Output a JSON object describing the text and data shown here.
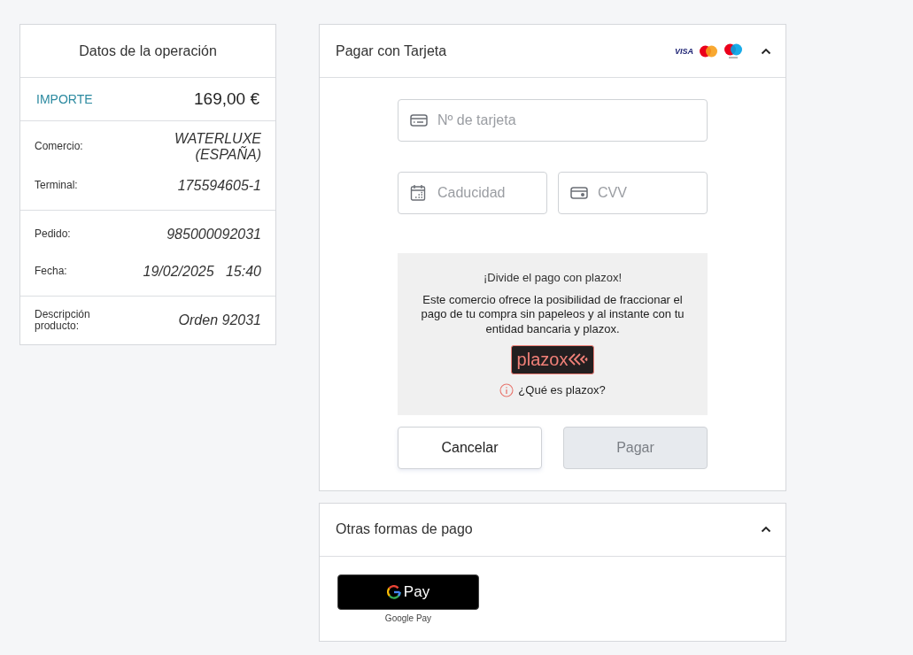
{
  "summary": {
    "title": "Datos de la operación",
    "amount_label": "IMPORTE",
    "amount": "169,00 €",
    "groups": [
      [
        {
          "label": "Comercio:",
          "value": "WATERLUXE (ESPAÑA)"
        },
        {
          "label": "Terminal:",
          "value": "175594605-1"
        }
      ],
      [
        {
          "label": "Pedido:",
          "value": "985000092031"
        },
        {
          "label": "Fecha:",
          "value": "19/02/2025   15:40"
        }
      ],
      [
        {
          "label": "Descripción producto:",
          "value": "Orden 92031"
        }
      ]
    ]
  },
  "card_section": {
    "title": "Pagar con Tarjeta",
    "expanded": true,
    "brand_visa": "VISA",
    "fields": [
      {
        "kind": "card",
        "placeholder": "Nº de tarjeta"
      },
      {
        "kind": "date",
        "placeholder": "Caducidad"
      },
      {
        "kind": "cvv",
        "placeholder": "CVV"
      }
    ],
    "promo": {
      "title": "¡Divide el pago con plazox!",
      "text": "Este comercio ofrece la posibilidad de fraccionar el pago de tu compra sin papeleos y al instante con tu entidad bancaria y plazox.",
      "logo": "plazox",
      "link": "¿Qué es plazox?"
    },
    "buttons": [
      {
        "label": "Cancelar",
        "disabled": false
      },
      {
        "label": "Pagar",
        "disabled": true
      }
    ]
  },
  "other_section": {
    "title": "Otras formas de pago",
    "expanded": true,
    "gpay_button": "Pay",
    "gpay_caption": "Google Pay"
  }
}
